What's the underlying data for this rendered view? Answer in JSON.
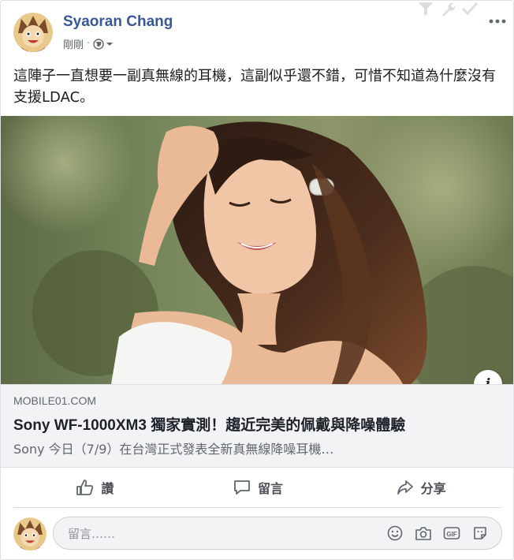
{
  "post": {
    "author": "Syaoran Chang",
    "time": "剛剛",
    "privacy_separator": "·",
    "text": "這陣子一直想要一副真無線的耳機，這副似乎還不錯，可惜不知道為什麼沒有支援LDAC。",
    "top_icons": [
      "filter-icon",
      "wrench-icon",
      "check-icon"
    ],
    "more_icon": "more-options-icon"
  },
  "link": {
    "domain": "MOBILE01.COM",
    "title": "Sony WF-1000XM3 獨家實測！趨近完美的佩戴與降噪體驗",
    "description": "Sony 今日（7/9）在台灣正式發表全新真無線降噪耳機…",
    "info_icon": "i"
  },
  "actions": [
    {
      "label": "讚",
      "icon": "thumbs-up-icon"
    },
    {
      "label": "留言",
      "icon": "comment-icon"
    },
    {
      "label": "分享",
      "icon": "share-icon"
    }
  ],
  "comment": {
    "placeholder": "留言……",
    "icons": [
      "emoji-icon",
      "camera-icon",
      "gif-icon",
      "sticker-icon"
    ]
  },
  "colors": {
    "author": "#385898",
    "text": "#1c1e21",
    "secondary": "#606770",
    "link_bg": "#f2f3f5"
  }
}
